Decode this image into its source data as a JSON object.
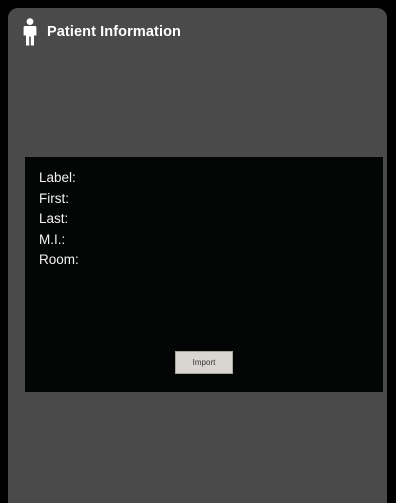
{
  "header": {
    "icon": "person-icon",
    "title": "Patient Information"
  },
  "fields": [
    {
      "label": "Label:"
    },
    {
      "label": "First:"
    },
    {
      "label": "Last:"
    },
    {
      "label": "M.I.:"
    },
    {
      "label": "Room:"
    }
  ],
  "actions": {
    "import_label": "Import"
  },
  "colors": {
    "background": "#000000",
    "panel": "#4a4a4a",
    "info_box": "#040606",
    "text": "#ffffff",
    "button": "#d9d6d1"
  }
}
